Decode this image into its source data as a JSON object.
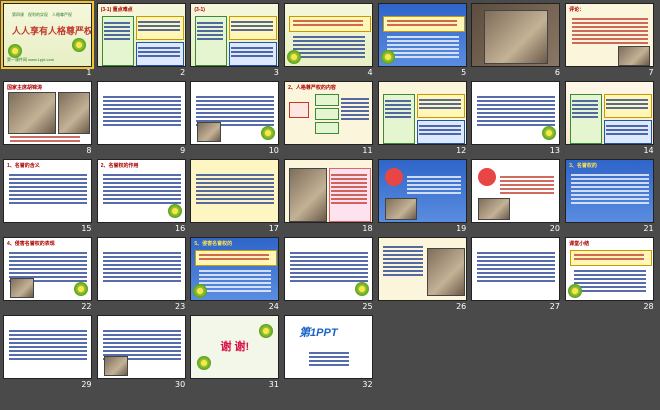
{
  "slides": [
    {
      "n": "1",
      "theme": "t-green",
      "kind": "title",
      "sub": "第四课　权利的实现　人格尊严权",
      "title": "人人享有人格尊严权",
      "foot": "第一课件网 www.1ppt.com"
    },
    {
      "n": "2",
      "theme": "t-green",
      "kind": "table",
      "hdr": "(3-1)  重点难点"
    },
    {
      "n": "3",
      "theme": "t-green",
      "kind": "table",
      "hdr": "(3-1)"
    },
    {
      "n": "4",
      "theme": "t-green",
      "kind": "list",
      "hdr": ""
    },
    {
      "n": "5",
      "theme": "t-blue",
      "kind": "list",
      "hdr": ""
    },
    {
      "n": "6",
      "theme": "t-photo",
      "kind": "photo",
      "hdr": ""
    },
    {
      "n": "7",
      "theme": "t-cream",
      "kind": "quote",
      "hdr": "评论："
    },
    {
      "n": "8",
      "theme": "t-white",
      "kind": "photo2",
      "hdr": "国家主席胡锦涛"
    },
    {
      "n": "9",
      "theme": "t-white",
      "kind": "text",
      "hdr": ""
    },
    {
      "n": "10",
      "theme": "t-white",
      "kind": "text",
      "hdr": ""
    },
    {
      "n": "11",
      "theme": "t-cream",
      "kind": "diagram",
      "hdr": "2、人格尊严权的内容"
    },
    {
      "n": "12",
      "theme": "t-cream",
      "kind": "table",
      "hdr": ""
    },
    {
      "n": "13",
      "theme": "t-white",
      "kind": "text",
      "hdr": ""
    },
    {
      "n": "14",
      "theme": "t-bright",
      "kind": "table",
      "hdr": ""
    },
    {
      "n": "15",
      "theme": "t-white",
      "kind": "text",
      "hdr": "1、名誉的含义"
    },
    {
      "n": "16",
      "theme": "t-white",
      "kind": "text",
      "hdr": "2、名誉权的作用"
    },
    {
      "n": "17",
      "theme": "t-yellow",
      "kind": "text",
      "hdr": ""
    },
    {
      "n": "18",
      "theme": "t-cream",
      "kind": "comic",
      "hdr": ""
    },
    {
      "n": "19",
      "theme": "t-blue",
      "kind": "question",
      "hdr": ""
    },
    {
      "n": "20",
      "theme": "t-white",
      "kind": "question",
      "hdr": ""
    },
    {
      "n": "21",
      "theme": "t-blue",
      "kind": "text",
      "hdr": "3、名誉权的"
    },
    {
      "n": "22",
      "theme": "t-white",
      "kind": "text",
      "hdr": "4、侵害名誉权的表现"
    },
    {
      "n": "23",
      "theme": "t-white",
      "kind": "text",
      "hdr": ""
    },
    {
      "n": "24",
      "theme": "t-blue",
      "kind": "list",
      "hdr": "5、侵害名誉权的"
    },
    {
      "n": "25",
      "theme": "t-white",
      "kind": "text",
      "hdr": ""
    },
    {
      "n": "26",
      "theme": "t-cream",
      "kind": "photo3",
      "hdr": ""
    },
    {
      "n": "27",
      "theme": "t-white",
      "kind": "text",
      "hdr": ""
    },
    {
      "n": "28",
      "theme": "t-white",
      "kind": "list",
      "hdr": "课堂小结"
    },
    {
      "n": "29",
      "theme": "t-white",
      "kind": "text",
      "hdr": ""
    },
    {
      "n": "30",
      "theme": "t-white",
      "kind": "text",
      "hdr": ""
    },
    {
      "n": "31",
      "theme": "t-pale",
      "kind": "thanks",
      "title": "谢 谢!"
    },
    {
      "n": "32",
      "theme": "t-white",
      "kind": "logo",
      "title": "第1PPT"
    }
  ],
  "selected": "1"
}
